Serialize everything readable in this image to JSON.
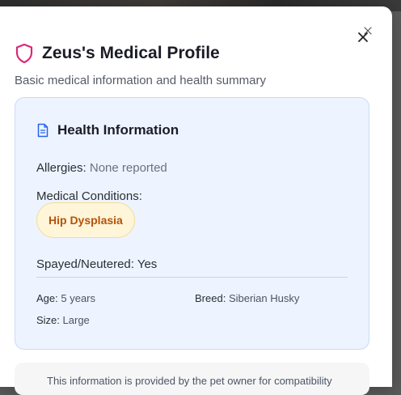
{
  "dialog": {
    "title": "Zeus's Medical Profile",
    "subtitle": "Basic medical information and health summary",
    "close_icon": "close-icon",
    "title_icon": "shield-icon"
  },
  "health_card": {
    "icon": "document-icon",
    "title": "Health Information",
    "allergies_label": "Allergies:",
    "allergies_value": "None reported",
    "conditions_label": "Medical Conditions:",
    "conditions": [
      "Hip Dysplasia"
    ],
    "spayed_label": "Spayed/Neutered:",
    "spayed_value": "Yes",
    "age_label": "Age:",
    "age_value": "5 years",
    "breed_label": "Breed:",
    "breed_value": "Siberian Husky",
    "size_label": "Size:",
    "size_value": "Large"
  },
  "footer": {
    "note": "This information is provided by the pet owner for compatibility"
  },
  "colors": {
    "accent_pink": "#db2777",
    "accent_blue": "#2563eb",
    "card_bg": "#edf4ff",
    "badge_text": "#b45309"
  }
}
